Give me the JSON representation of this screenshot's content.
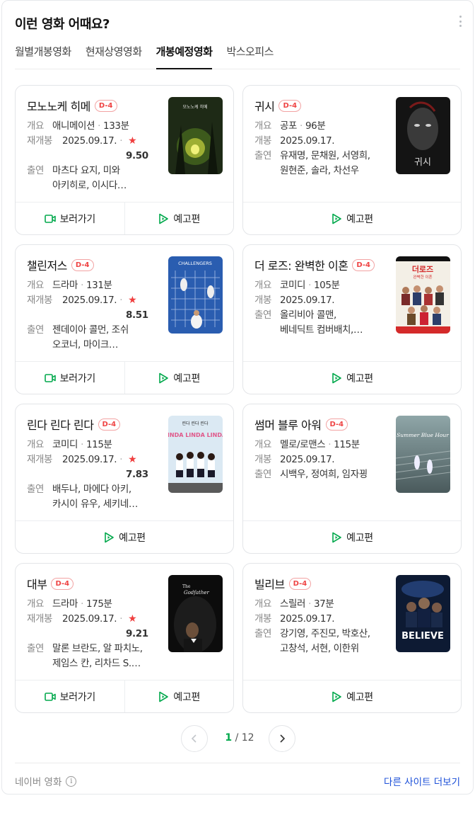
{
  "header": {
    "title": "이런 영화 어때요?",
    "more_icon": "more-vertical-icon"
  },
  "tabs": [
    {
      "label": "월별개봉영화",
      "active": false
    },
    {
      "label": "현재상영영화",
      "active": false
    },
    {
      "label": "개봉예정영화",
      "active": true
    },
    {
      "label": "박스오피스",
      "active": false
    }
  ],
  "labels": {
    "genre": "개요",
    "rerelease": "재개봉",
    "release": "개봉",
    "cast": "출연",
    "watch": "보러가기",
    "trailer": "예고편"
  },
  "movies": [
    {
      "title": "모노노케 히메",
      "dday": "D-4",
      "genre": "애니메이션",
      "runtime": "133분",
      "date_label": "재개봉",
      "date": "2025.09.17.",
      "rating": "9.50",
      "cast_line1": "마츠다 요지, 미와",
      "cast_line2": "아키히로, 이시다…",
      "watch": true
    },
    {
      "title": "귀시",
      "dday": "D-4",
      "genre": "공포",
      "runtime": "96분",
      "date_label": "개봉",
      "date": "2025.09.17.",
      "rating": "",
      "cast_line1": "유재명, 문채원, 서영희,",
      "cast_line2": "원현준, 솔라, 차선우",
      "watch": false
    },
    {
      "title": "챌린저스",
      "dday": "D-4",
      "genre": "드라마",
      "runtime": "131분",
      "date_label": "재개봉",
      "date": "2025.09.17.",
      "rating": "8.51",
      "cast_line1": "젠데이아 콜먼, 조쉬",
      "cast_line2": "오코너, 마이크…",
      "watch": true
    },
    {
      "title": "더 로즈: 완벽한 이혼",
      "dday": "D-4",
      "genre": "코미디",
      "runtime": "105분",
      "date_label": "개봉",
      "date": "2025.09.17.",
      "rating": "",
      "cast_line1": "올리비아 콜맨,",
      "cast_line2": "베네딕트 컴버배치,…",
      "watch": false
    },
    {
      "title": "린다 린다 린다",
      "dday": "D-4",
      "genre": "코미디",
      "runtime": "115분",
      "date_label": "재개봉",
      "date": "2025.09.17.",
      "rating": "7.83",
      "cast_line1": "배두나, 마에다 아키,",
      "cast_line2": "카시이 유우, 세키네…",
      "watch": false
    },
    {
      "title": "썸머 블루 아워",
      "dday": "D-4",
      "genre": "멜로/로맨스",
      "runtime": "115분",
      "date_label": "개봉",
      "date": "2025.09.17.",
      "rating": "",
      "cast_line1": "시백우, 정여희, 임자끵",
      "cast_line2": "",
      "watch": false
    },
    {
      "title": "대부",
      "dday": "D-4",
      "genre": "드라마",
      "runtime": "175분",
      "date_label": "재개봉",
      "date": "2025.09.17.",
      "rating": "9.21",
      "cast_line1": "말론 브란도, 알 파치노,",
      "cast_line2": "제임스 칸, 리차드 S.…",
      "watch": true
    },
    {
      "title": "빌리브",
      "dday": "D-4",
      "genre": "스릴러",
      "runtime": "37분",
      "date_label": "개봉",
      "date": "2025.09.17.",
      "rating": "",
      "cast_line1": "강기영, 주진모, 박호산,",
      "cast_line2": "고창석, 서현, 이한위",
      "watch": false
    }
  ],
  "posters": {
    "p1": "모노노케 히메",
    "p3": "CHALLENGERS",
    "p4": "더로즈",
    "p4sub": "완벽한 이혼",
    "p5": "린다 린다 린다",
    "p5en": "LINDA LINDA LINDA",
    "p7a": "The",
    "p7b": "Godfather",
    "p2": "귀시",
    "p8": "BELIEVE",
    "p6": "Summer Blue Hour"
  },
  "pager": {
    "current": "1",
    "separator": "/",
    "total": "12"
  },
  "footer": {
    "source": "네이버 영화",
    "more_link": "다른 사이트 더보기"
  },
  "colors": {
    "accent_green": "#03a94d",
    "badge_red": "#ef4444",
    "star_red": "#f03e3e",
    "link_blue": "#1b4fd8"
  }
}
